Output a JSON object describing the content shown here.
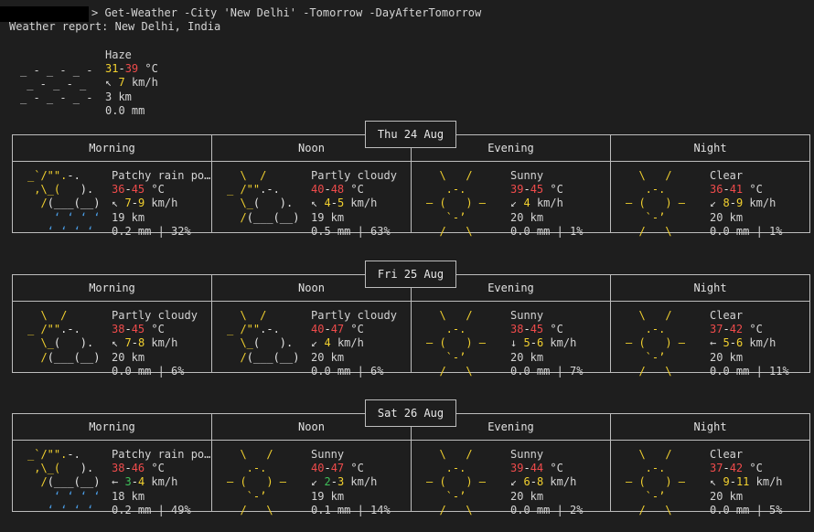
{
  "terminal": {
    "command": "> Get-Weather -City 'New Delhi' -Tomorrow -DayAfterTomorrow",
    "report_title": "Weather report: New Delhi, India"
  },
  "current": {
    "condition": "Haze",
    "temp_min": "31",
    "temp_max": "39",
    "temp_unit": "°C",
    "wind_arrow": "↖",
    "wind_speed": "7",
    "wind_unit": "km/h",
    "visibility": "3 km",
    "precip": "0.0 mm",
    "art": [
      "_ - _ - _ -",
      " _ - _ - _",
      "_ - _ - _ -"
    ]
  },
  "colors": {
    "temp": "#ef4b4b",
    "wind": "#f2d12f",
    "wind_green": "#3fc05a",
    "sun": "#f2d12f",
    "rain": "#4a9ee8",
    "background": "#1e1e1e"
  },
  "period_names": [
    "Morning",
    "Noon",
    "Evening",
    "Night"
  ],
  "days": [
    {
      "date": "Thu 24 Aug",
      "periods": [
        {
          "icon": "patchy-rain",
          "condition": "Patchy rain po…",
          "t1": "36",
          "t2": "45",
          "wind_arrow": "↖",
          "w1": "7",
          "w2": "9",
          "wind_color": "yellow",
          "visibility": "19 km",
          "precip": "0.2 mm | 32%"
        },
        {
          "icon": "partly-cloudy",
          "condition": "Partly cloudy",
          "t1": "40",
          "t2": "48",
          "wind_arrow": "↖",
          "w1": "4",
          "w2": "5",
          "wind_color": "yellow",
          "visibility": "19 km",
          "precip": "0.5 mm | 63%"
        },
        {
          "icon": "sunny",
          "condition": "Sunny",
          "t1": "39",
          "t2": "45",
          "wind_arrow": "↙",
          "w1": "4",
          "w2": "",
          "wind_color": "yellow",
          "visibility": "20 km",
          "precip": "0.0 mm | 1%"
        },
        {
          "icon": "clear",
          "condition": "Clear",
          "t1": "36",
          "t2": "41",
          "wind_arrow": "↙",
          "w1": "8",
          "w2": "9",
          "wind_color": "yellow",
          "visibility": "20 km",
          "precip": "0.0 mm | 1%"
        }
      ]
    },
    {
      "date": "Fri 25 Aug",
      "periods": [
        {
          "icon": "partly-cloudy",
          "condition": "Partly cloudy",
          "t1": "38",
          "t2": "45",
          "wind_arrow": "↖",
          "w1": "7",
          "w2": "8",
          "wind_color": "yellow",
          "visibility": "20 km",
          "precip": "0.0 mm | 6%"
        },
        {
          "icon": "partly-cloudy",
          "condition": "Partly cloudy",
          "t1": "40",
          "t2": "47",
          "wind_arrow": "↙",
          "w1": "4",
          "w2": "",
          "wind_color": "yellow",
          "visibility": "20 km",
          "precip": "0.0 mm | 6%"
        },
        {
          "icon": "sunny",
          "condition": "Sunny",
          "t1": "38",
          "t2": "45",
          "wind_arrow": "↓",
          "w1": "5",
          "w2": "6",
          "wind_color": "yellow",
          "visibility": "20 km",
          "precip": "0.0 mm | 7%"
        },
        {
          "icon": "clear",
          "condition": "Clear",
          "t1": "37",
          "t2": "42",
          "wind_arrow": "←",
          "w1": "5",
          "w2": "6",
          "wind_color": "yellow",
          "visibility": "20 km",
          "precip": "0.0 mm | 11%"
        }
      ]
    },
    {
      "date": "Sat 26 Aug",
      "periods": [
        {
          "icon": "patchy-rain",
          "condition": "Patchy rain po…",
          "t1": "38",
          "t2": "46",
          "wind_arrow": "←",
          "w1": "3",
          "w2": "4",
          "wind_color": "green",
          "visibility": "18 km",
          "precip": "0.2 mm | 49%"
        },
        {
          "icon": "sunny",
          "condition": "Sunny",
          "t1": "40",
          "t2": "47",
          "wind_arrow": "↙",
          "w1": "2",
          "w2": "3",
          "wind_color": "green",
          "visibility": "19 km",
          "precip": "0.1 mm | 14%"
        },
        {
          "icon": "sunny",
          "condition": "Sunny",
          "t1": "39",
          "t2": "44",
          "wind_arrow": "↙",
          "w1": "6",
          "w2": "8",
          "wind_color": "yellow",
          "visibility": "20 km",
          "precip": "0.0 mm | 2%"
        },
        {
          "icon": "clear",
          "condition": "Clear",
          "t1": "37",
          "t2": "42",
          "wind_arrow": "↖",
          "w1": "9",
          "w2": "11",
          "wind_color": "yellow",
          "visibility": "20 km",
          "precip": "0.0 mm | 5%"
        }
      ]
    }
  ],
  "units": {
    "temp": "°C",
    "wind": "km/h"
  }
}
